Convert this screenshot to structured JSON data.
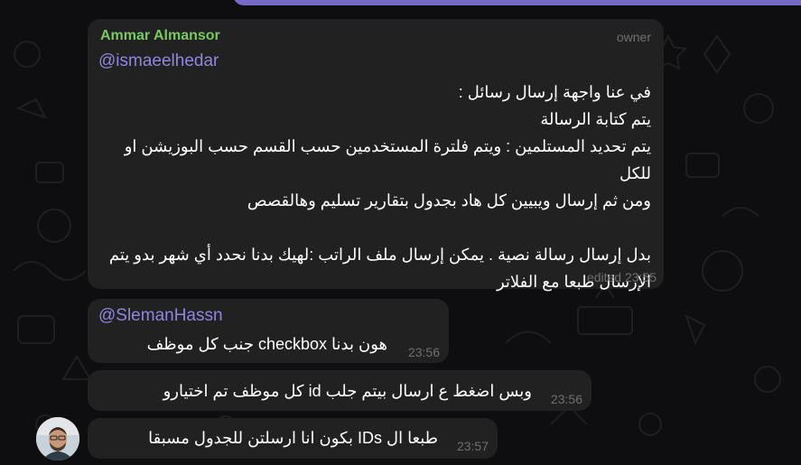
{
  "colors": {
    "chat_background": "#0e0e10",
    "bubble": "#212121",
    "sender_name": "#7bc862",
    "mention": "#8e86e0",
    "meta_text": "#6f6f72",
    "outgoing_bubble": "#766ac8"
  },
  "messages": [
    {
      "sender": "Ammar Almansor",
      "badge": "owner",
      "mention": "@ismaeelhedar",
      "text": "في عنا واجهة إرسال رسائل :\nيتم كتابة الرسالة\nيتم تحديد المستلمين : ويتم فلترة المستخدمين حسب القسم حسب البوزيشن او للكل\nومن ثم إرسال ويبيين كل هاد بجدول بتقارير تسليم وهالقصص\n\nبدل إرسال رسالة نصية . يمكن إرسال ملف الراتب :لهيك بدنا نحدد أي شهر بدو يتم الإرسال طبعا مع الفلاتر",
      "time": "edited 23:55"
    },
    {
      "mention": "@SlemanHassn",
      "text": "هون بدنا checkbox جنب كل موظف",
      "time": "23:56"
    },
    {
      "text": "وبس اضغط ع ارسال بيتم جلب id كل موظف تم اختيارو",
      "time": "23:56"
    },
    {
      "text": "طبعا ال IDs بكون انا ارسلتن للجدول مسبقا",
      "time": "23:57",
      "avatar": "sender-avatar"
    }
  ]
}
